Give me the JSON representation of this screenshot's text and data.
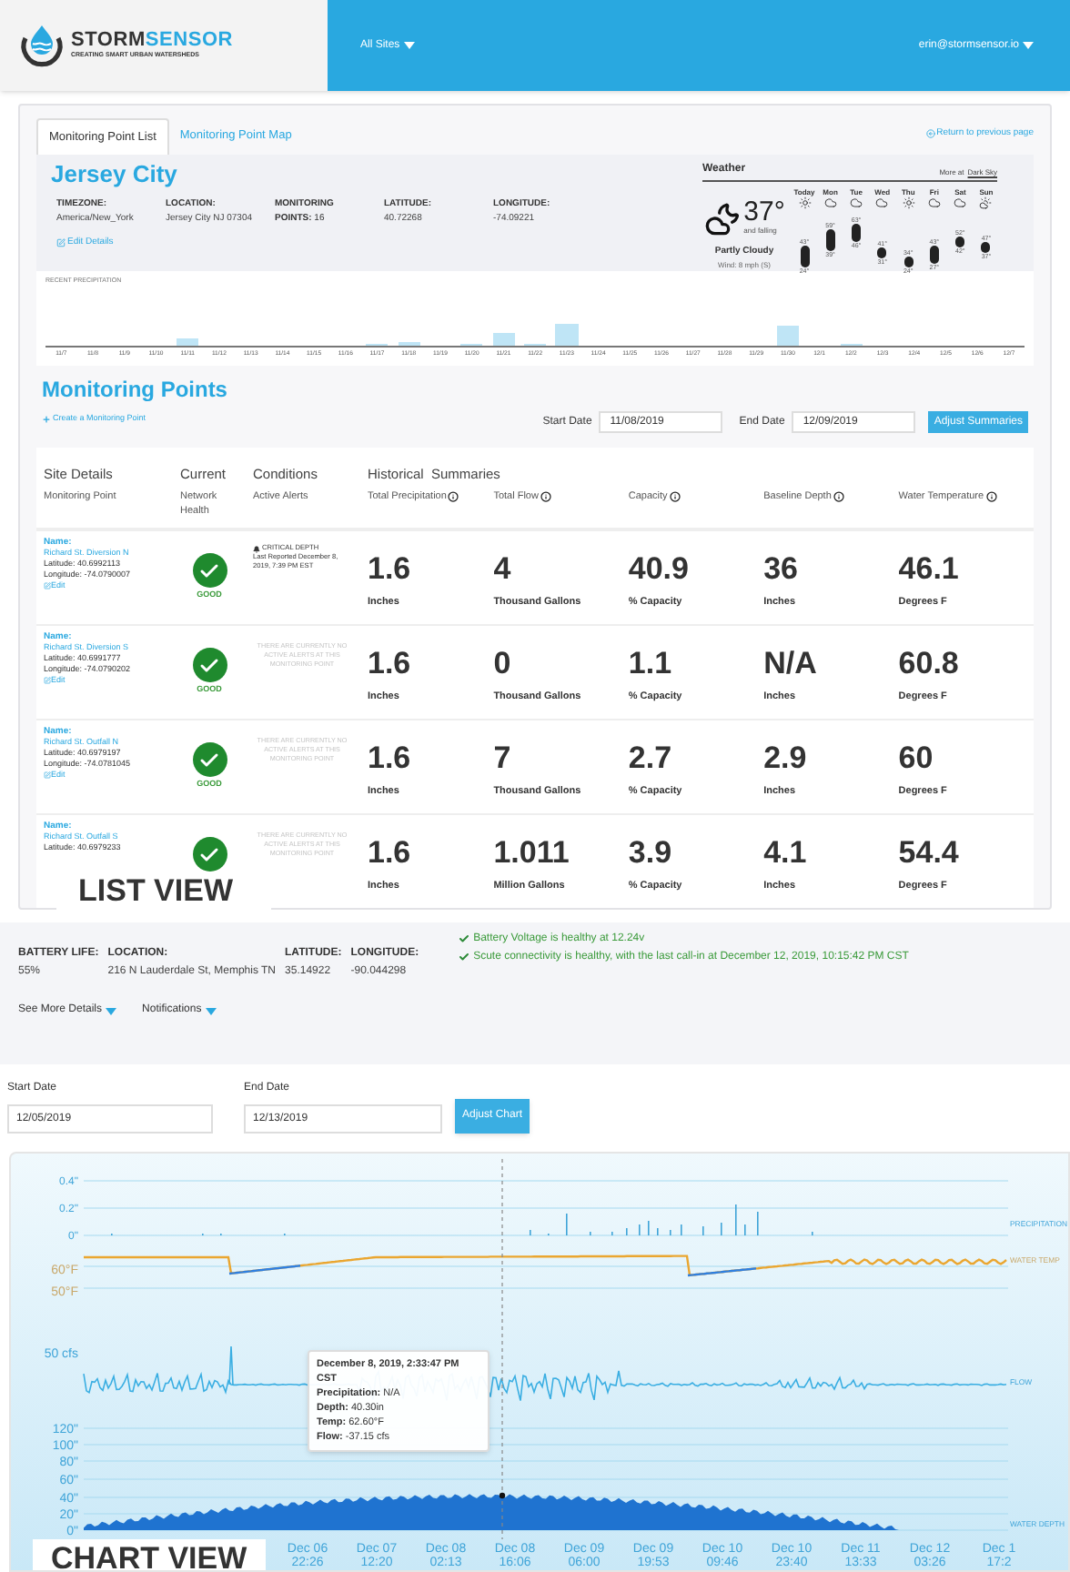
{
  "header": {
    "logo_primary": "STORM",
    "logo_secondary": "SENSOR",
    "tagline": "CREATING SMART URBAN WATERSHEDS",
    "site_menu": "All Sites",
    "user_menu": "erin@stormsensor.io"
  },
  "list_view": {
    "tabs": [
      {
        "label": "Monitoring Point List",
        "selected": true
      },
      {
        "label": "Monitoring Point Map",
        "selected": false
      }
    ],
    "return_link": "Return to previous page",
    "site": {
      "title": "Jersey City",
      "fields": [
        {
          "kind": "stacked",
          "label": "TIMEZONE:",
          "value": "America/New_York"
        },
        {
          "kind": "stacked",
          "label": "LOCATION:",
          "value": "Jersey City NJ 07304"
        },
        {
          "kind": "inline",
          "label": "MONITORING POINTS:",
          "value": "16"
        },
        {
          "kind": "stacked",
          "label": "LATITUDE:",
          "value": "40.72268"
        },
        {
          "kind": "stacked",
          "label": "LONGITUDE:",
          "value": "-74.09221"
        }
      ],
      "edit_link": "Edit Details"
    },
    "weather": {
      "title": "Weather",
      "more_prefix": "More at",
      "more_link": "Dark Sky",
      "current_temp": "37°",
      "trend": "and falling",
      "summary": "Partly Cloudy",
      "wind": "Wind: 8 mph (S)",
      "forecast": [
        {
          "day": "Today",
          "kind": "sun",
          "high": "43°",
          "low": "24°"
        },
        {
          "day": "Mon",
          "kind": "cloud",
          "high": "59°",
          "low": "39°"
        },
        {
          "day": "Tue",
          "kind": "cloud",
          "high": "63°",
          "low": "46°"
        },
        {
          "day": "Wed",
          "kind": "cloud",
          "high": "41°",
          "low": "31°"
        },
        {
          "day": "Thu",
          "kind": "sun",
          "high": "34°",
          "low": "24°"
        },
        {
          "day": "Fri",
          "kind": "cloud",
          "high": "43°",
          "low": "27°"
        },
        {
          "day": "Sat",
          "kind": "cloud",
          "high": "52°",
          "low": "42°"
        },
        {
          "day": "Sun",
          "kind": "partly",
          "high": "47°",
          "low": "37°"
        }
      ]
    },
    "precipitation": {
      "title": "RECENT PRECIPITATION",
      "dates": [
        "11/7",
        "11/8",
        "11/9",
        "11/10",
        "11/11",
        "11/12",
        "11/13",
        "11/14",
        "11/15",
        "11/16",
        "11/17",
        "11/18",
        "11/19",
        "11/20",
        "11/21",
        "11/22",
        "11/23",
        "11/24",
        "11/25",
        "11/26",
        "11/27",
        "11/28",
        "11/29",
        "11/30",
        "12/1",
        "12/2",
        "12/3",
        "12/4",
        "12/5",
        "12/6",
        "12/7"
      ]
    },
    "monitoring": {
      "title": "Monitoring Points",
      "create_link": "Create a Monitoring Point",
      "start_label": "Start Date",
      "start_value": "11/08/2019",
      "end_label": "End Date",
      "end_value": "12/09/2019",
      "button": "Adjust Summaries",
      "group_headers": [
        "Site Details",
        "Current",
        "Conditions",
        "Historical  Summaries"
      ],
      "columns": [
        {
          "label": "Monitoring Point",
          "info": false
        },
        {
          "label": "Network Health",
          "info": false
        },
        {
          "label": "Active Alerts",
          "info": false
        },
        {
          "label": "Total Precipitation",
          "info": true
        },
        {
          "label": "Total Flow",
          "info": true
        },
        {
          "label": "Capacity",
          "info": true
        },
        {
          "label": "Baseline Depth",
          "info": true
        },
        {
          "label": "Water Temperature",
          "info": true
        }
      ],
      "rows": [
        {
          "name_label": "Name:",
          "name": "Richard St. Diversion N",
          "latitude": "Latitude: 40.6992113",
          "longitude": "Longitude: -74.0790007",
          "edit": "Edit",
          "health": "GOOD",
          "alert": {
            "kind": "critical",
            "title": "CRITICAL DEPTH",
            "detail": "Last Reported December 8, 2019, 7:39 PM EST"
          },
          "metrics": [
            {
              "value": "1.6",
              "unit": "Inches"
            },
            {
              "value": "4",
              "unit": "Thousand Gallons"
            },
            {
              "value": "40.9",
              "unit": "% Capacity"
            },
            {
              "value": "36",
              "unit": "Inches"
            },
            {
              "value": "46.1",
              "unit": "Degrees F"
            }
          ]
        },
        {
          "name_label": "Name:",
          "name": "Richard St. Diversion S",
          "latitude": "Latitude: 40.6991777",
          "longitude": "Longitude: -74.0790202",
          "edit": "Edit",
          "health": "GOOD",
          "alert": {
            "kind": "none",
            "detail": "THERE ARE CURRENTLY NO ACTIVE ALERTS AT THIS MONITORING POINT"
          },
          "metrics": [
            {
              "value": "1.6",
              "unit": "Inches"
            },
            {
              "value": "0",
              "unit": "Thousand Gallons"
            },
            {
              "value": "1.1",
              "unit": "% Capacity"
            },
            {
              "value": "N/A",
              "unit": "Inches"
            },
            {
              "value": "60.8",
              "unit": "Degrees F"
            }
          ]
        },
        {
          "name_label": "Name:",
          "name": "Richard St. Outfall N",
          "latitude": "Latitude: 40.6979197",
          "longitude": "Longitude: -74.0781045",
          "edit": "Edit",
          "health": "GOOD",
          "alert": {
            "kind": "none",
            "detail": "THERE ARE CURRENTLY NO ACTIVE ALERTS AT THIS MONITORING POINT"
          },
          "metrics": [
            {
              "value": "1.6",
              "unit": "Inches"
            },
            {
              "value": "7",
              "unit": "Thousand Gallons"
            },
            {
              "value": "2.7",
              "unit": "% Capacity"
            },
            {
              "value": "2.9",
              "unit": "Inches"
            },
            {
              "value": "60",
              "unit": "Degrees F"
            }
          ]
        },
        {
          "name_label": "Name:",
          "name": "Richard St. Outfall S",
          "latitude": "Latitude: 40.6979233",
          "alert": {
            "kind": "none",
            "detail": "THERE ARE CURRENTLY NO ACTIVE ALERTS AT THIS MONITORING POINT"
          },
          "metrics": [
            {
              "value": "1.6",
              "unit": "Inches"
            },
            {
              "value": "1.011",
              "unit": "Million Gallons"
            },
            {
              "value": "3.9",
              "unit": "% Capacity"
            },
            {
              "value": "4.1",
              "unit": "Inches"
            },
            {
              "value": "54.4",
              "unit": "Degrees F"
            }
          ]
        }
      ]
    },
    "caption": "LIST VIEW"
  },
  "chart_view": {
    "fields": [
      {
        "label": "BATTERY LIFE:",
        "value": "55%"
      },
      {
        "label": "LOCATION:",
        "value": "216 N Lauderdale St, Memphis TN"
      },
      {
        "label": "LATITUDE:",
        "value": "35.14922"
      },
      {
        "label": "LONGITUDE:",
        "value": "-90.044298"
      }
    ],
    "health_messages": [
      "Battery Voltage is healthy at 12.24v",
      "Scute connectivity is healthy, with the last call-in at December 12, 2019, 10:15:42 PM CST"
    ],
    "menus": [
      "See More Details",
      "Notifications"
    ],
    "start_label": "Start Date",
    "start_value": "12/05/2019",
    "end_label": "End Date",
    "end_value": "12/13/2019",
    "button": "Adjust Chart",
    "chart": {
      "precip_ticks": [
        "0.4\"",
        "0.2\"",
        "0\""
      ],
      "temp_ticks": [
        "60°F",
        "50°F"
      ],
      "flow_ticks": [
        "50 cfs"
      ],
      "depth_ticks": [
        "120\"",
        "100\"",
        "80\"",
        "60\"",
        "40\"",
        "20\"",
        "0\""
      ],
      "series_labels": [
        "PRECIPITATION",
        "WATER TEMP",
        "FLOW",
        "WATER DEPTH"
      ],
      "x_ticks": [
        {
          "date": "Dec 06",
          "time": "22:26"
        },
        {
          "date": "Dec 07",
          "time": "12:20"
        },
        {
          "date": "Dec 08",
          "time": "02:13"
        },
        {
          "date": "Dec 08",
          "time": "16:06"
        },
        {
          "date": "Dec 09",
          "time": "06:00"
        },
        {
          "date": "Dec 09",
          "time": "19:53"
        },
        {
          "date": "Dec 10",
          "time": "09:46"
        },
        {
          "date": "Dec 10",
          "time": "23:40"
        },
        {
          "date": "Dec 11",
          "time": "13:33"
        },
        {
          "date": "Dec 12",
          "time": "03:26"
        },
        {
          "date": "Dec 1",
          "time": "17:2"
        }
      ],
      "tooltip": {
        "title": "December 8, 2019, 2:33:47 PM CST",
        "lines": [
          "**Precipitation:** N/A",
          "**Depth:** 40.30in",
          "**Temp:** 62.60°F",
          "**Flow:** -37.15 cfs"
        ]
      }
    },
    "caption": "CHART VIEW"
  }
}
